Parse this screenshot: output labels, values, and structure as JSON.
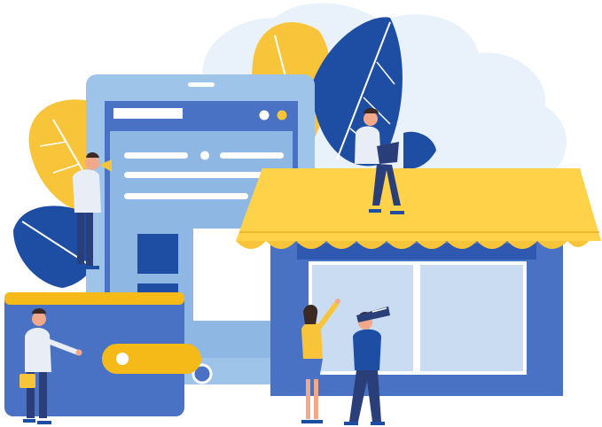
{
  "illustration": {
    "colors": {
      "cloud": "#e9f1fb",
      "leaf_yellow": "#f8c53a",
      "leaf_blue": "#1e4ea3",
      "device_frame": "#9fc4ea",
      "device_screen": "#4a72c4",
      "device_panel": "#ffffff",
      "awning": "#ffd24a",
      "shop_wall": "#4a72c4",
      "window_glass": "#c9dcf2",
      "wallet": "#4a72c4",
      "wallet_strap": "#f5b918",
      "skin": "#f2a98a",
      "shirt_light": "#e9eef6",
      "pants_dark": "#2a3f7a"
    },
    "icons": [
      "cloud-shape",
      "leaf-icon",
      "tablet-device",
      "storefront",
      "awning",
      "wallet-icon",
      "megaphone-icon",
      "laptop-icon",
      "telescope-icon",
      "briefcase-icon"
    ]
  }
}
